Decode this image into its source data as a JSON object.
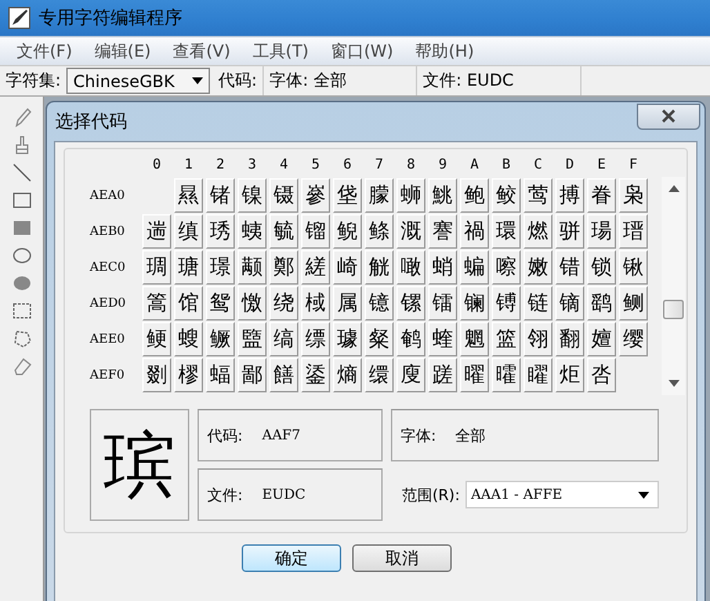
{
  "window": {
    "title": "专用字符编辑程序"
  },
  "menu": [
    "文件(F)",
    "编辑(E)",
    "查看(V)",
    "工具(T)",
    "窗口(W)",
    "帮助(H)"
  ],
  "toolbar": {
    "charset_label": "字符集:",
    "charset": "ChineseGBK",
    "code_label": "代码:",
    "font": "字体: 全部",
    "file": "文件: EUDC"
  },
  "dialog": {
    "title": "选择代码",
    "columns": [
      "0",
      "1",
      "2",
      "3",
      "4",
      "5",
      "6",
      "7",
      "8",
      "9",
      "A",
      "B",
      "C",
      "D",
      "E",
      "F"
    ],
    "rows": [
      {
        "code": "AEA0",
        "chars": [
          {
            "kind": "empty"
          },
          "㬎",
          "锗",
          "镍",
          "镊",
          "嵾",
          "垡",
          "朦",
          "蛳",
          "鮡",
          "鲍",
          "鲛",
          "莺",
          "搏",
          "眷",
          "枭"
        ]
      },
      {
        "code": "AEB0",
        "chars": [
          "遄",
          "缜",
          "琇",
          "蛦",
          "毓",
          "镏",
          "鲵",
          "鲦",
          "溉",
          "謇",
          "禍",
          "環",
          "燃",
          "骈",
          "瑒",
          "瑨"
        ]
      },
      {
        "code": "AEC0",
        "chars": [
          "琱",
          "瑭",
          "璟",
          "颟",
          "鄭",
          "縒",
          "崎",
          "觥",
          "噉",
          "蛸",
          "蝙",
          "嚓",
          "嫩",
          "错",
          "锁",
          "锹"
        ]
      },
      {
        "code": "AED0",
        "chars": [
          "篙",
          "馆",
          "鸳",
          "憿",
          "绕",
          "棫",
          "属",
          "镱",
          "镙",
          "镭",
          "镧",
          "镈",
          "链",
          "镝",
          "鹞",
          "鲗"
        ]
      },
      {
        "code": "AEE0",
        "chars": [
          "鲠",
          "螋",
          "鳜",
          "盬",
          "缟",
          "缥",
          "璩",
          "粲",
          "鹌",
          "蝰",
          "魍",
          "篮",
          "翎",
          "翻",
          "嬗",
          "缨"
        ]
      },
      {
        "code": "AEF0",
        "chars": [
          "剟",
          "樛",
          "蝠",
          "鄙",
          "饍",
          "鋈",
          "熵",
          "缳",
          "廋",
          "蹉",
          "曜",
          "曤",
          "矅",
          "炬",
          "呇",
          {
            "kind": "empty"
          }
        ]
      }
    ],
    "preview": "瑸",
    "code_label": "代码:",
    "code": "AAF7",
    "font_label": "字体:",
    "font": "全部",
    "file_label": "文件:",
    "file": "EUDC",
    "range_label": "范围(R):",
    "range": "AAA1 - AFFE",
    "buttons": [
      {
        "label": "确定",
        "default": true
      },
      {
        "label": "取消",
        "default": false
      }
    ]
  }
}
